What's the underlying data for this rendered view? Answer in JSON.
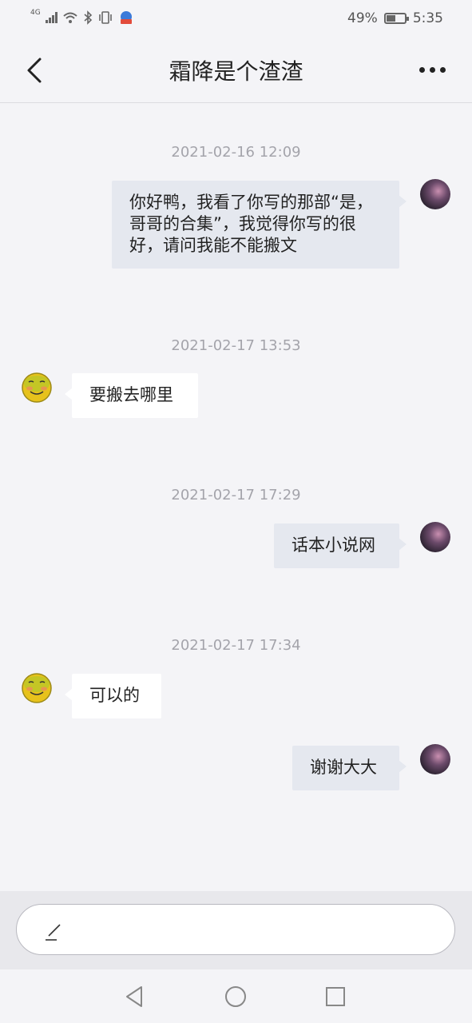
{
  "status": {
    "network_label": "4G",
    "battery_percent_text": "49%",
    "battery_level": 0.49,
    "time": "5:35"
  },
  "nav": {
    "title": "霜降是个渣渣",
    "back_icon": "back-arrow-icon",
    "more_icon": "more-icon"
  },
  "chat": [
    {
      "timestamp": "2021-02-16 12:09"
    },
    {
      "sender": "me",
      "text": "你好鸭，我看了你写的那部“是，哥哥的合集”，我觉得你写的很好，请问我能不能搬文"
    },
    {
      "timestamp": "2021-02-17 13:53"
    },
    {
      "sender": "other",
      "text": "要搬去哪里"
    },
    {
      "timestamp": "2021-02-17 17:29"
    },
    {
      "sender": "me",
      "text": "话本小说网"
    },
    {
      "timestamp": "2021-02-17 17:34"
    },
    {
      "sender": "other",
      "text": "可以的"
    },
    {
      "sender": "me",
      "text": "谢谢大大"
    }
  ],
  "input": {
    "placeholder": "",
    "icon": "pen-icon"
  },
  "system_nav": {
    "icons": [
      "back-triangle-icon",
      "home-circle-icon",
      "recents-square-icon"
    ]
  },
  "colors": {
    "background": "#f4f4f7",
    "bubble_out": "#e5e8ef",
    "bubble_in": "#ffffff",
    "timestamp_text": "#a4a4ab"
  }
}
